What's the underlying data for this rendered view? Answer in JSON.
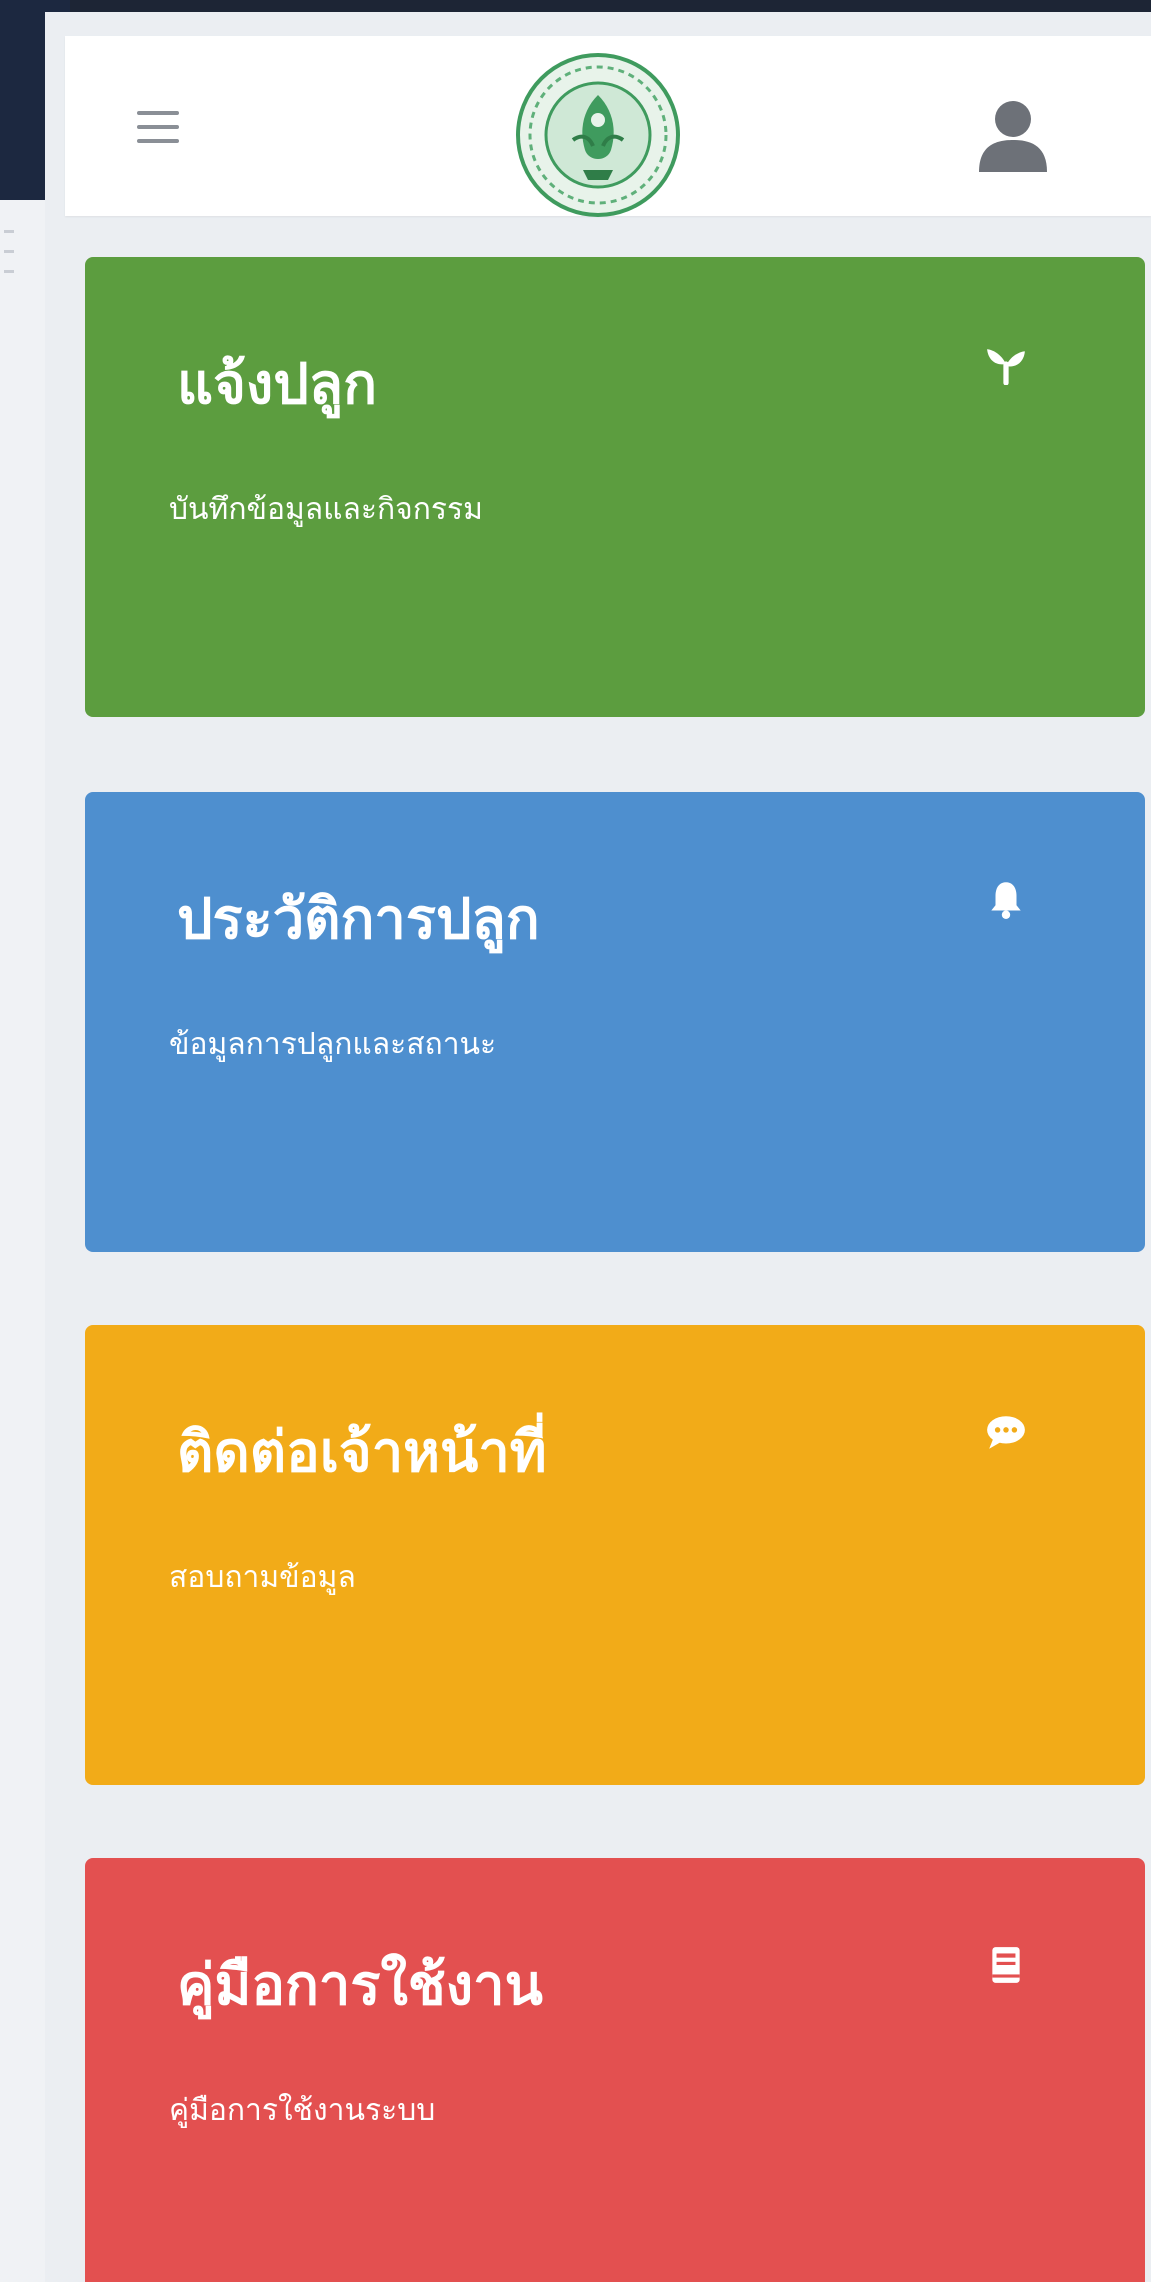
{
  "header": {
    "menu_icon": "hamburger-menu-icon",
    "logo_icon": "government-seal-logo",
    "user_icon": "user-avatar-icon"
  },
  "cards": [
    {
      "title": "แจ้งปลูก",
      "subtitle": "บันทึกข้อมูลและกิจกรรม",
      "icon": "seedling-icon",
      "color": "#5c9d3f"
    },
    {
      "title": "ประวัติการปลูก",
      "subtitle": "ข้อมูลการปลูกและสถานะ",
      "icon": "bell-icon",
      "color": "#4e8fcf"
    },
    {
      "title": "ติดต่อเจ้าหน้าที่",
      "subtitle": "สอบถามข้อมูล",
      "icon": "chat-bubble-icon",
      "color": "#f2ab18"
    },
    {
      "title": "คู่มือการใช้งาน",
      "subtitle": "คู่มือการใช้งานระบบ",
      "icon": "book-icon",
      "color": "#e35050"
    }
  ]
}
